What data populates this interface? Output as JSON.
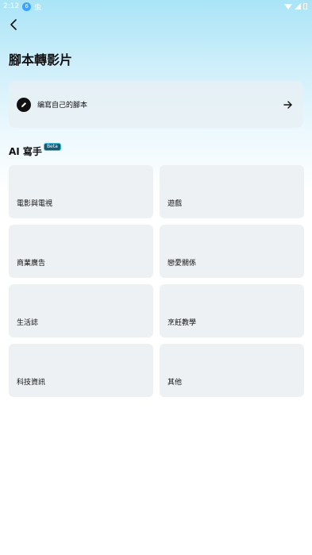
{
  "status_bar": {
    "time": "2:12",
    "notification_badge": "6",
    "carrier_label": "虫"
  },
  "page": {
    "title": "腳本轉影片"
  },
  "write_own": {
    "label": "编寫自己的腳本"
  },
  "ai_writer": {
    "title": "AI 寫手",
    "badge": "Beta"
  },
  "categories": [
    {
      "label": "電影與電視"
    },
    {
      "label": "遊戲"
    },
    {
      "label": "商業廣告"
    },
    {
      "label": "戀愛關係"
    },
    {
      "label": "生活誌"
    },
    {
      "label": "烹飪教學"
    },
    {
      "label": "科技資訊"
    },
    {
      "label": "其他"
    }
  ],
  "icons": {
    "back": "chevron-left-icon",
    "pen": "pen-icon",
    "arrow": "arrow-right-icon"
  }
}
